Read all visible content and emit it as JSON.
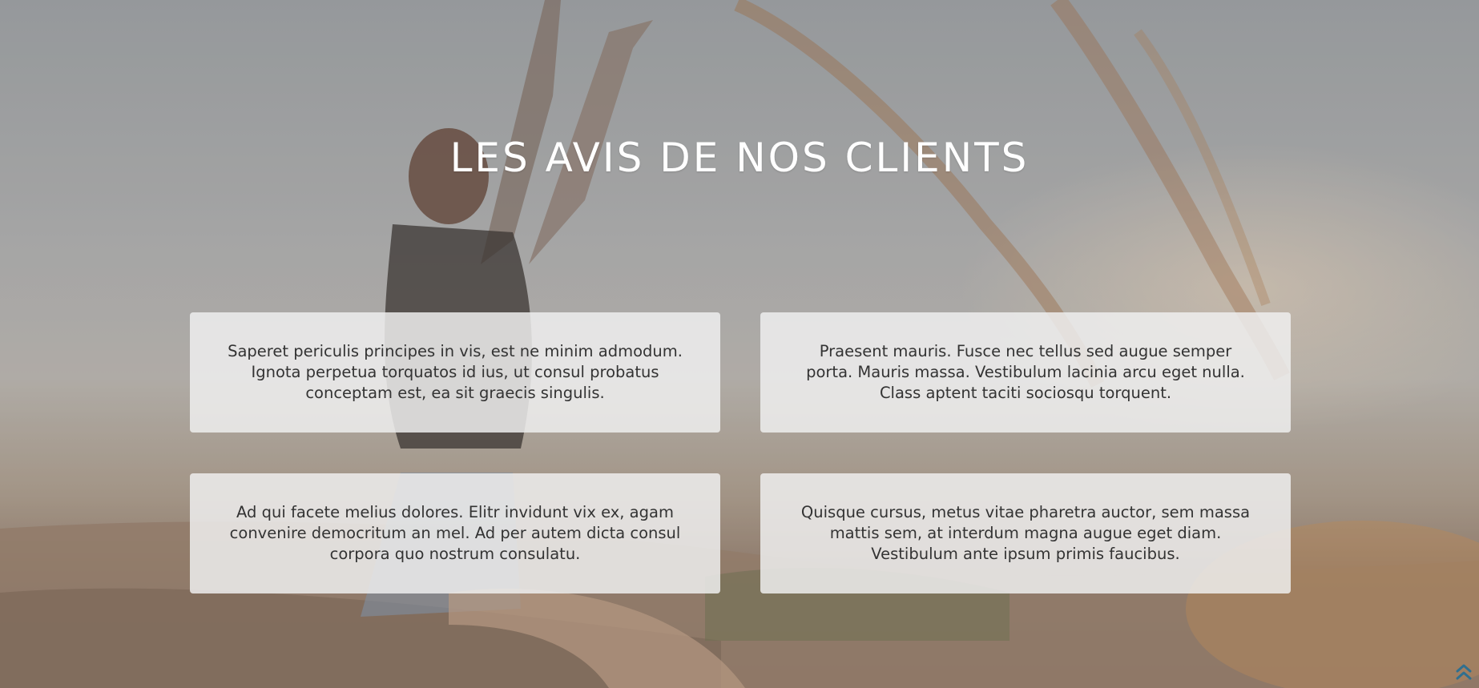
{
  "section": {
    "title": "LES AVIS DE NOS CLIENTS"
  },
  "testimonials": [
    {
      "text": "Saperet periculis principes in vis, est ne minim admodum. Ignota perpetua torquatos id ius, ut consul probatus conceptam est, ea sit graecis singulis."
    },
    {
      "text": "Praesent mauris. Fusce nec tellus sed augue semper porta. Mauris massa. Vestibulum lacinia arcu eget nulla. Class aptent taciti sociosqu torquent."
    },
    {
      "text": "Ad qui facete melius dolores. Elitr invidunt vix ex, agam convenire democritum an mel. Ad per autem dicta consul corpora quo nostrum consulatu."
    },
    {
      "text": "Quisque cursus, metus vitae pharetra auctor, sem massa mattis sem, at interdum magna augue eget diam. Vestibulum ante ipsum primis faucibus."
    }
  ],
  "icons": {
    "scroll_top": "double-chevron-up-icon"
  },
  "colors": {
    "title": "#ffffff",
    "card_background": "#f0f0f0",
    "card_text": "#333333",
    "scroll_icon": "#2f6f8f"
  }
}
